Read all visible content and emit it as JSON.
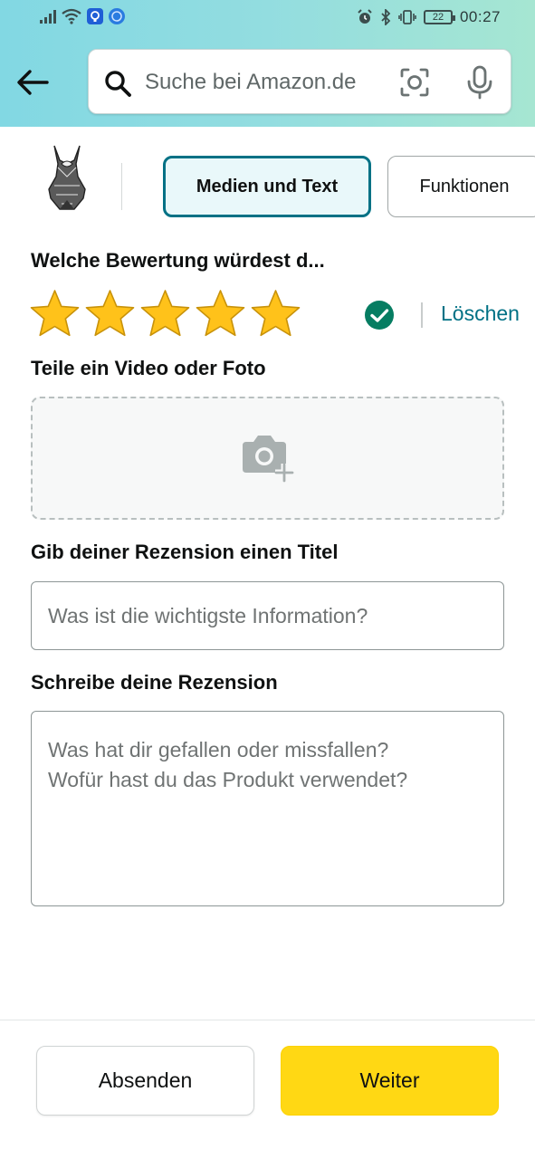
{
  "status_bar": {
    "time": "00:27",
    "battery": "22",
    "icons": [
      "signal-icon",
      "wifi-icon",
      "app-icon",
      "browser-icon",
      "alarm-icon",
      "bluetooth-icon",
      "vibrate-icon",
      "battery-icon"
    ]
  },
  "header": {
    "back_icon": "arrow-left-icon",
    "search": {
      "placeholder": "Suche bei Amazon.de",
      "value": "",
      "icons": [
        "search-icon",
        "camera-scan-icon",
        "mic-icon"
      ]
    }
  },
  "tabs": [
    {
      "label": "Medien und Text",
      "active": true
    },
    {
      "label": "Funktionen",
      "active": false
    }
  ],
  "rating": {
    "question": "Welche Bewertung würdest d...",
    "stars_selected": 5,
    "stars_total": 5,
    "delete_label": "Löschen"
  },
  "media": {
    "title": "Teile ein Video oder Foto",
    "icon": "add-photo-icon"
  },
  "review_title": {
    "label": "Gib deiner Rezension einen Titel",
    "placeholder": "Was ist die wichtigste Information?",
    "value": ""
  },
  "review_body": {
    "label": "Schreibe deine Rezension",
    "placeholder": "Was hat dir gefallen oder missfallen?\nWofür hast du das Produkt verwendet?",
    "value": ""
  },
  "footer": {
    "submit_label": "Absenden",
    "next_label": "Weiter"
  },
  "colors": {
    "accent_teal": "#007185",
    "star_yellow": "#ffc21a",
    "primary_button": "#ffd814",
    "check_green": "#067d62"
  }
}
